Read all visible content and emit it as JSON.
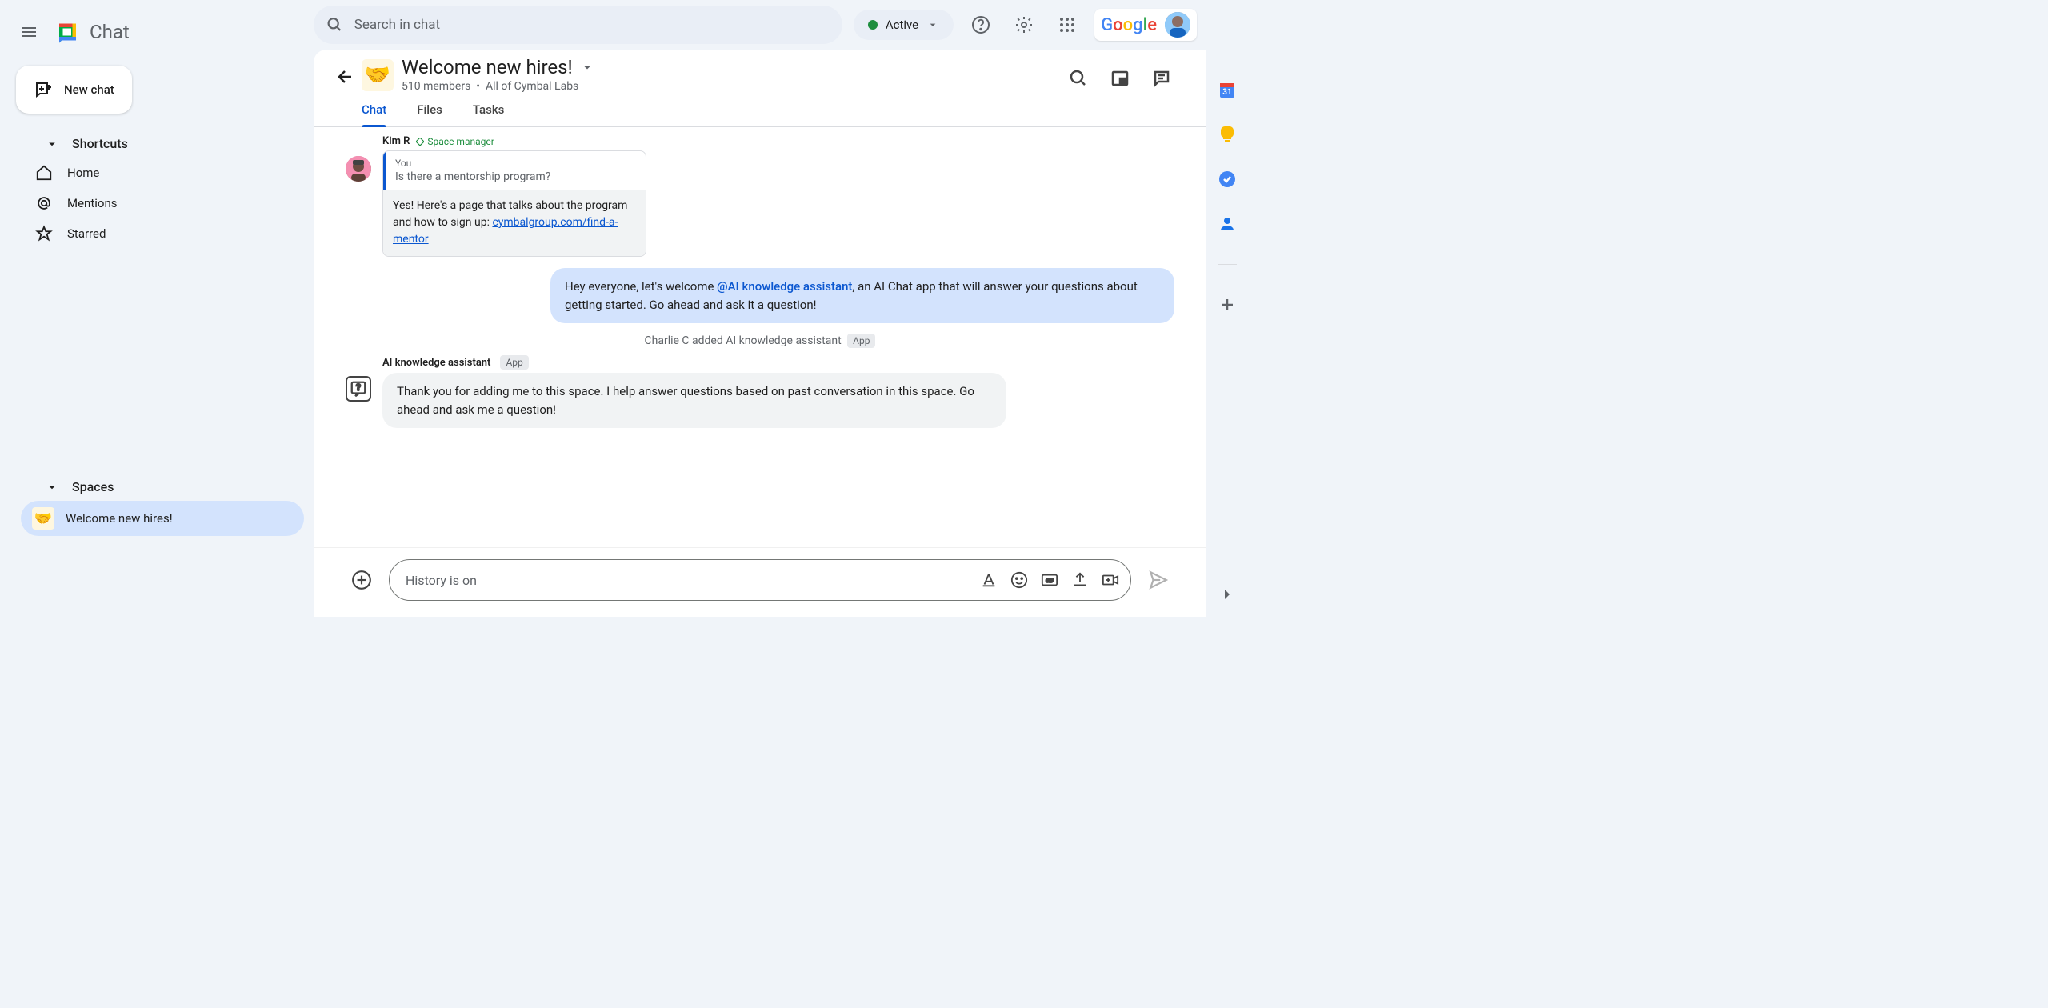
{
  "app": {
    "name": "Chat",
    "search_placeholder": "Search in chat",
    "status": "Active",
    "google_logo": "Google"
  },
  "sidebar": {
    "new_chat_label": "New chat",
    "shortcuts_label": "Shortcuts",
    "nav_items": [
      {
        "label": "Home"
      },
      {
        "label": "Mentions"
      },
      {
        "label": "Starred"
      }
    ],
    "spaces_label": "Spaces",
    "spaces": [
      {
        "label": "Welcome new hires!",
        "emoji": "🤝"
      }
    ]
  },
  "space": {
    "emoji": "🤝",
    "title": "Welcome new hires!",
    "members": "510 members",
    "org": "All of Cymbal Labs"
  },
  "tabs": [
    {
      "label": "Chat",
      "active": true
    },
    {
      "label": "Files",
      "active": false
    },
    {
      "label": "Tasks",
      "active": false
    }
  ],
  "messages": {
    "kim": {
      "author": "Kim R",
      "badge": "Space manager",
      "quote_you": "You",
      "quote_text": "Is there a mentorship program?",
      "reply_text": "Yes! Here's a page that talks about the program and how to sign up: ",
      "reply_link": "cymbalgroup.com/find-a-mentor"
    },
    "own": {
      "prefix": "Hey everyone, let's welcome ",
      "mention": "@AI knowledge assistant",
      "suffix": ", an AI Chat app that will answer your questions about getting started.  Go ahead and ask it a question!"
    },
    "system": {
      "text": "Charlie C added AI knowledge assistant",
      "badge": "App"
    },
    "assistant": {
      "author": "AI knowledge assistant",
      "badge": "App",
      "text": "Thank you for adding me to this space. I help answer questions based on past conversation in this space. Go ahead and ask me a question!"
    }
  },
  "compose": {
    "placeholder": "History is on"
  }
}
